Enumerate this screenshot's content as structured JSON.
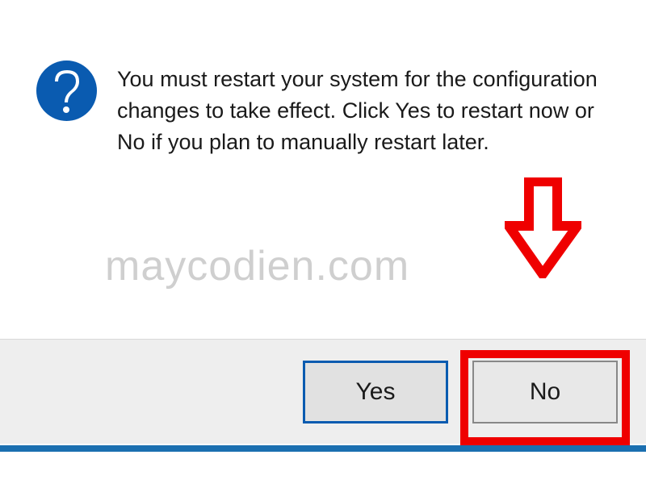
{
  "dialog": {
    "message": "You must restart your system for the configuration changes to take effect. Click Yes to restart now or No if you plan to manually restart later.",
    "icon_name": "question-mark"
  },
  "buttons": {
    "yes_label": "Yes",
    "no_label": "No"
  },
  "watermark": {
    "text": "maycodien.com"
  },
  "annotation": {
    "highlight_target": "no-button",
    "highlight_color": "#ef0000"
  },
  "colors": {
    "accent": "#0a5bb0",
    "button_bg": "#e8e8e8",
    "bar_bg": "#eeeeee"
  }
}
